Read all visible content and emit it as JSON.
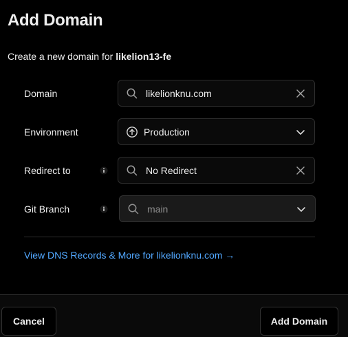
{
  "dialog": {
    "title": "Add Domain",
    "subtitle_prefix": "Create a new domain for ",
    "project_name": "likelion13-fe"
  },
  "form": {
    "domain": {
      "label": "Domain",
      "value": "likelionknu.com",
      "lead_icon": "search-icon",
      "trail_icon": "close-icon"
    },
    "environment": {
      "label": "Environment",
      "value": "Production",
      "lead_icon": "arrow-up-circle-icon",
      "trail_icon": "chevron-down-icon"
    },
    "redirect": {
      "label": "Redirect to",
      "value": "No Redirect",
      "lead_icon": "search-icon",
      "trail_icon": "close-icon",
      "info_icon": "info-icon"
    },
    "git_branch": {
      "label": "Git Branch",
      "placeholder": "main",
      "lead_icon": "search-icon",
      "trail_icon": "chevron-down-icon",
      "info_icon": "info-icon"
    }
  },
  "dns_link": "View DNS Records & More for likelionknu.com →",
  "footer": {
    "cancel_label": "Cancel",
    "submit_label": "Add Domain"
  },
  "colors": {
    "background": "#000000",
    "text": "#ededed",
    "muted": "#8f8f8f",
    "border": "#2e2e2e",
    "link": "#52a8ff"
  }
}
